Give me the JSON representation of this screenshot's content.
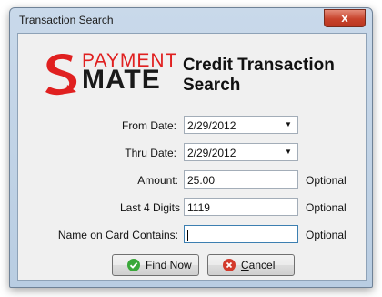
{
  "window": {
    "title": "Transaction Search",
    "close_glyph": "x"
  },
  "logo": {
    "word1": "PAYMENT",
    "word2": "MATE",
    "mark_icon": "swirl-s-icon",
    "brand_color": "#e02020"
  },
  "heading": "Credit Transaction Search",
  "form": {
    "from_date": {
      "label": "From Date:",
      "value": "2/29/2012"
    },
    "thru_date": {
      "label": "Thru Date:",
      "value": "2/29/2012"
    },
    "amount": {
      "label": "Amount:",
      "value": "25.00",
      "hint": "Optional"
    },
    "last4": {
      "label": "Last 4 Digits",
      "value": "1119",
      "hint": "Optional"
    },
    "name_on_card": {
      "label": "Name on Card Contains:",
      "value": "",
      "hint": "Optional"
    }
  },
  "buttons": {
    "find": {
      "label": "Find Now",
      "icon": "check-circle-icon",
      "color": "#3aa83a"
    },
    "cancel": {
      "label_prefix": "C",
      "label_rest": "ancel",
      "icon": "x-circle-icon",
      "color": "#d33a2c"
    }
  }
}
